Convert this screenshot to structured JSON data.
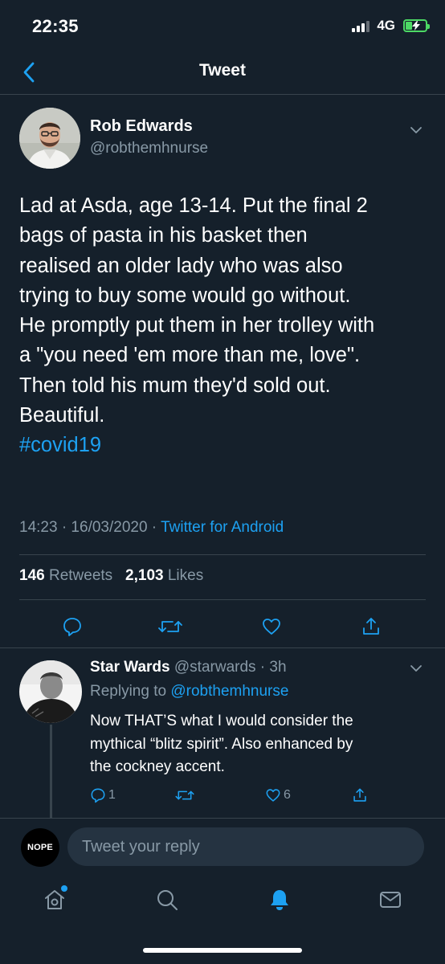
{
  "status_bar": {
    "time": "22:35",
    "network": "4G"
  },
  "nav": {
    "title": "Tweet"
  },
  "tweet": {
    "author_name": "Rob Edwards",
    "author_handle": "@robthemhnurse",
    "text_lines": [
      "Lad at Asda, age 13-14. Put the final 2",
      "bags of pasta in his basket then",
      "realised an older lady who was also",
      "trying to buy some would go without.",
      "He promptly put them in her trolley with",
      "a \"you need 'em more than me, love\".",
      "Then told his mum they'd sold out.",
      "Beautiful."
    ],
    "hashtag": "#covid19",
    "timestamp": "14:23 · 16/03/2020 ·",
    "source": "Twitter for Android",
    "retweets_count": "146",
    "retweets_label": "Retweets",
    "likes_count": "2,103",
    "likes_label": "Likes"
  },
  "reply": {
    "name": "Star Wards",
    "meta": "@starwards · 3h",
    "replying_prefix": "Replying to",
    "replying_to": "@robthemhnurse",
    "text_lines": [
      "Now THAT’S what I would consider the",
      "mythical “blitz spirit”. Also enhanced by",
      "the cockney accent."
    ],
    "reply_count": "1",
    "like_count": "6"
  },
  "composer": {
    "avatar_text": "NOPE",
    "placeholder": "Tweet your reply"
  },
  "colors": {
    "background": "#15202b",
    "accent": "#1da1f2",
    "secondary_text": "#8899a6",
    "divider": "#38444d",
    "battery": "#4cd964"
  },
  "icons": {
    "nav": "back-chevron-icon",
    "actions": [
      "reply-icon",
      "retweet-icon",
      "like-icon",
      "share-icon"
    ],
    "tabs": [
      "home-icon",
      "search-icon",
      "notifications-icon",
      "messages-icon"
    ]
  },
  "battery_level": 0.35
}
